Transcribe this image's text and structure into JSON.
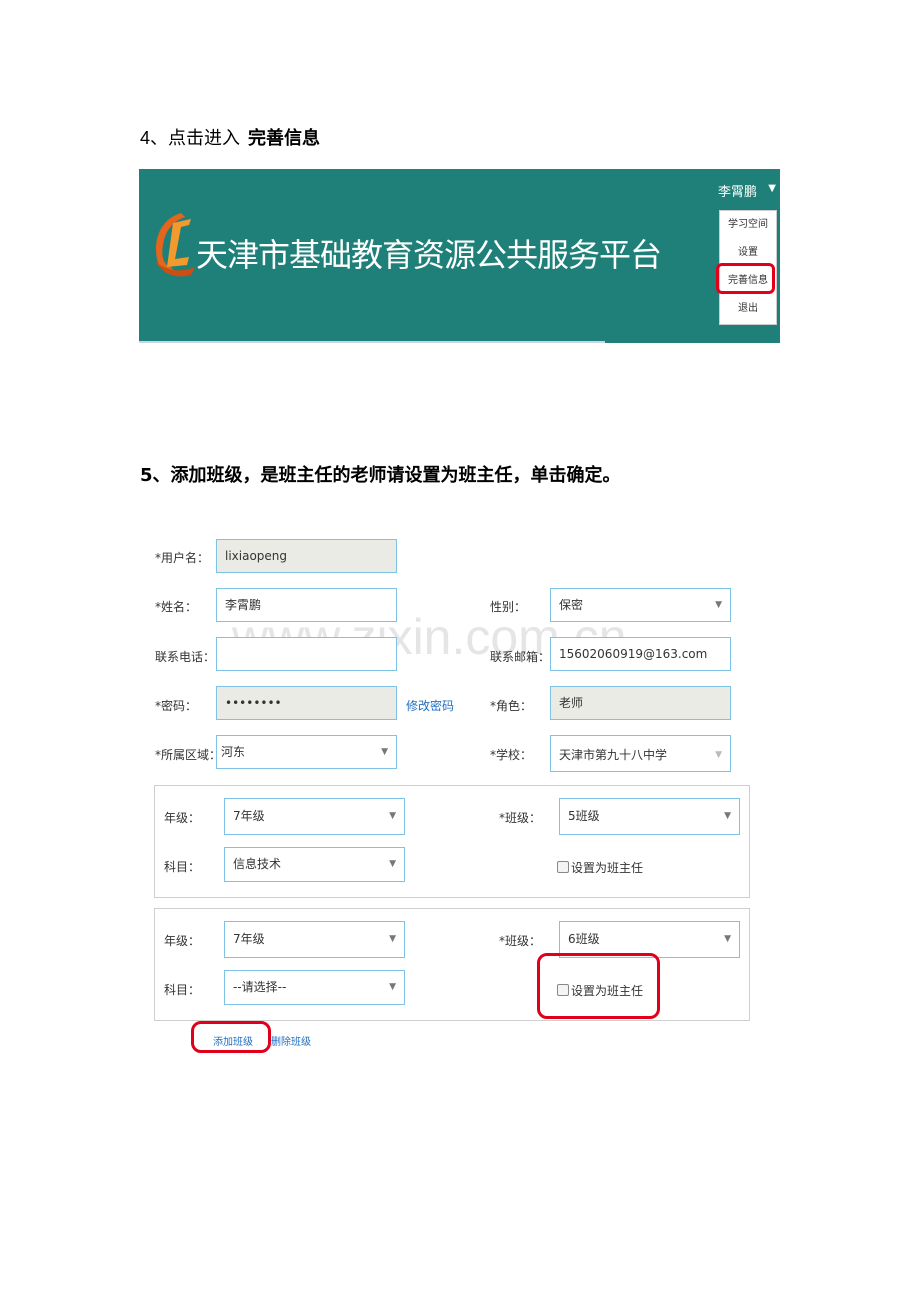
{
  "step4": {
    "number": "4",
    "text": "、点击进入",
    "bold": "完善信息"
  },
  "banner": {
    "site_title": "天津市基础教育资源公共服务平台",
    "user_name": "李霄鹏",
    "caret": "▼",
    "menu": [
      "学习空间",
      "设置",
      "完善信息",
      "退出"
    ]
  },
  "step5": {
    "text": "5、添加班级，是班主任的老师请设置为班主任，单击确定。"
  },
  "watermark": "www.zixin.com.cn",
  "form": {
    "username": {
      "label": "*用户名：",
      "value": "lixiaopeng"
    },
    "name": {
      "label": "*姓名：",
      "value": "李霄鹏"
    },
    "gender": {
      "label": "性别：",
      "value": "保密"
    },
    "phone": {
      "label": "联系电话：",
      "value": ""
    },
    "email": {
      "label": "联系邮箱：",
      "value": "15602060919@163.com"
    },
    "password": {
      "label": "*密码：",
      "value": "••••••••",
      "change_link": "修改密码"
    },
    "role": {
      "label": "*角色：",
      "value": "老师"
    },
    "region": {
      "label": "*所属区域：",
      "value": "河东"
    },
    "school": {
      "label": "*学校：",
      "value": "天津市第九十八中学"
    },
    "classes": [
      {
        "grade_label": "年级：",
        "grade": "7年级",
        "class_label": "*班级：",
        "class": "5班级",
        "subject_label": "科目：",
        "subject": "信息技术",
        "head_teacher": "设置为班主任"
      },
      {
        "grade_label": "年级：",
        "grade": "7年级",
        "class_label": "*班级：",
        "class": "6班级",
        "subject_label": "科目：",
        "subject": "--请选择--",
        "head_teacher": "设置为班主任"
      }
    ],
    "add_class": "添加班级",
    "delete_class": "删除班级"
  }
}
